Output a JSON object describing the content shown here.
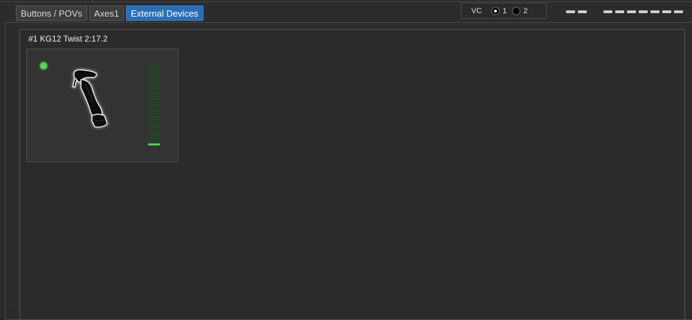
{
  "tabs": [
    {
      "label": "Buttons / POVs",
      "active": false
    },
    {
      "label": "Axes1",
      "active": false
    },
    {
      "label": "External Devices",
      "active": true
    }
  ],
  "vc": {
    "label": "VC",
    "options": [
      {
        "label": "1",
        "checked": true
      },
      {
        "label": "2",
        "checked": false
      }
    ]
  },
  "device": {
    "title": "#1 KG12 Twist 2:17.2",
    "status": "connected",
    "status_color": "#4ddc4d",
    "icon": "joystick-twist-icon",
    "level_fraction": 0.0
  },
  "colors": {
    "accent": "#2a6fb6",
    "level_on": "#49d649",
    "level_off": "#1f4a1f"
  }
}
